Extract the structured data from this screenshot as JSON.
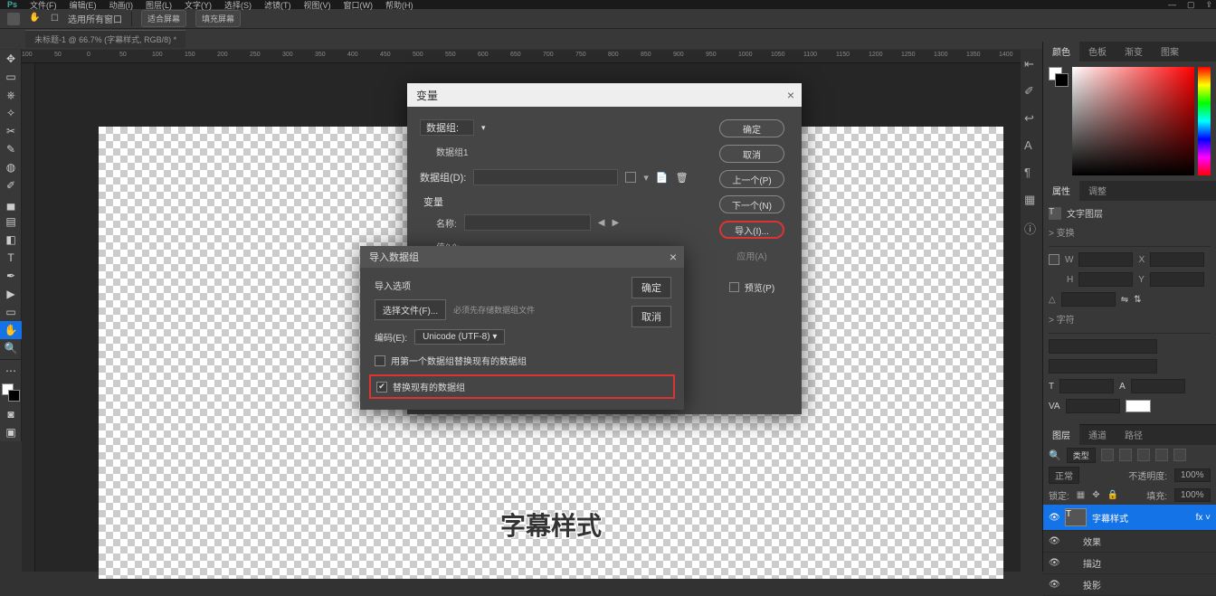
{
  "menubar": [
    "文件(F)",
    "编辑(E)",
    "动画(I)",
    "图层(L)",
    "文字(Y)",
    "选择(S)",
    "滤镜(T)",
    "视图(V)",
    "窗口(W)",
    "帮助(H)"
  ],
  "optbar": {
    "label1": "选用所有窗口"
  },
  "doc_tab": "未标题-1 @ 66.7% (字幕样式, RGB/8) *",
  "ruler_ticks": [
    "100",
    "50",
    "0",
    "50",
    "100",
    "150",
    "200",
    "250",
    "300",
    "350",
    "400",
    "450",
    "500",
    "550",
    "600",
    "650",
    "700",
    "750",
    "800",
    "850",
    "900",
    "950",
    "1000",
    "1050",
    "1100",
    "1150",
    "1200",
    "1250",
    "1300",
    "1350",
    "1400"
  ],
  "tools": [
    "✥",
    "▭",
    "⎈",
    "✎",
    "✂",
    "▤",
    "◑",
    "✐",
    "▀",
    "≡",
    "T",
    "▶",
    "◻",
    "✋",
    "🔍",
    "⋯"
  ],
  "subtitle_text": "字幕样式",
  "panel_tabs_top": [
    "颜色",
    "色板",
    "渐变",
    "图案"
  ],
  "panel_tabs_mid": [
    "属性",
    "调整"
  ],
  "prop": {
    "type_label": "文字图层",
    "transform_section": "> 变换",
    "w": "W",
    "h": "H",
    "x": "X",
    "y": "Y",
    "angle": "角度",
    "char_section": "> 字符"
  },
  "panel_tabs_bot": [
    "图层",
    "通道",
    "路径"
  ],
  "layers": {
    "filter": "类型",
    "blend": "正常",
    "opacity_lbl": "不透明度:",
    "opacity": "100%",
    "lock_lbl": "锁定:",
    "fill_lbl": "填充:",
    "fill": "100%",
    "items": [
      {
        "name": "字幕样式",
        "sel": true,
        "fx": true
      },
      {
        "name": "效果",
        "indent": 1
      },
      {
        "name": "描边",
        "indent": 1
      },
      {
        "name": "投影",
        "indent": 1
      }
    ]
  },
  "dlg1": {
    "title": "变量",
    "group_lbl": "数据组:",
    "group_val": "数据组1",
    "datasets_lbl": "数据组(D):",
    "var_section": "变量",
    "name_lbl": "名称:",
    "value_lbl": "值(V):",
    "btns": {
      "ok": "确定",
      "cancel": "取消",
      "prev": "上一个(P)",
      "next": "下一个(N)",
      "import": "导入(I)...",
      "apply": "应用(A)"
    },
    "preview": "预览(P)"
  },
  "dlg2": {
    "title": "导入数据组",
    "section": "导入选项",
    "select_file": "选择文件(F)...",
    "hint": "必须先存储数据组文件",
    "encoding_lbl": "编码(E):",
    "encoding_val": "Unicode (UTF-8)",
    "chk1": "用第一个数据组替换现有的数据组",
    "chk2": "替换现有的数据组",
    "ok": "确定",
    "cancel": "取消"
  }
}
